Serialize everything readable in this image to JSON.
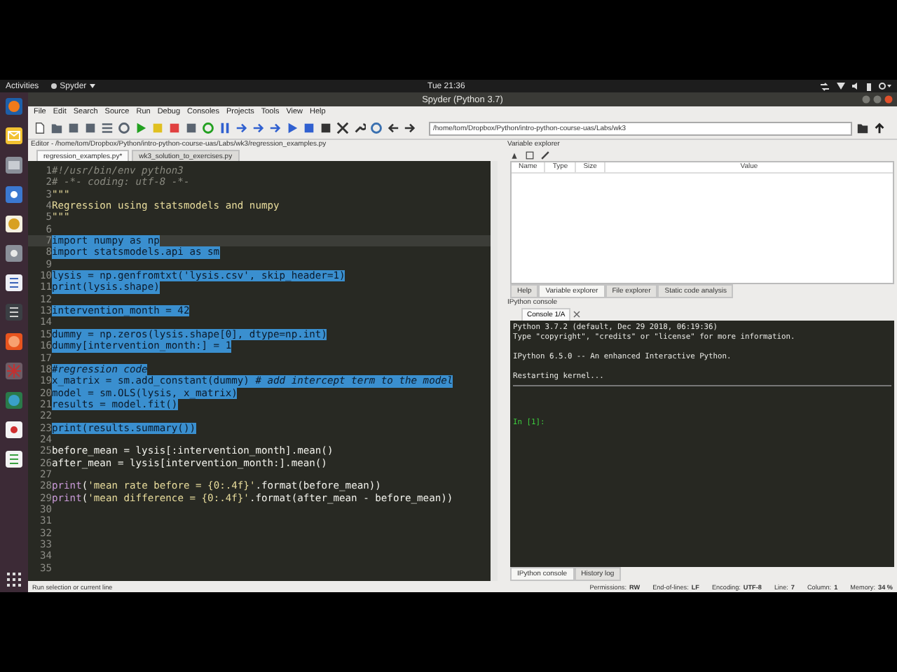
{
  "topbar": {
    "activities": "Activities",
    "app_menu": "Spyder",
    "clock": "Tue 21:36"
  },
  "window": {
    "title": "Spyder (Python 3.7)"
  },
  "menu": [
    "File",
    "Edit",
    "Search",
    "Source",
    "Run",
    "Debug",
    "Consoles",
    "Projects",
    "Tools",
    "View",
    "Help"
  ],
  "toolbar": {
    "path": "/home/tom/Dropbox/Python/intro-python-course-uas/Labs/wk3"
  },
  "editor": {
    "title": "Editor - /home/tom/Dropbox/Python/intro-python-course-uas/Labs/wk3/regression_examples.py",
    "tabs": [
      {
        "label": "regression_examples.py*",
        "selected": true
      },
      {
        "label": "wk3_solution_to_exercises.py",
        "selected": false
      }
    ],
    "lines": [
      {
        "number": "1",
        "selected": false,
        "current": false,
        "parts": [
          {
            "kind": "comment",
            "text": "#!/usr/bin/env python3"
          }
        ]
      },
      {
        "number": "2",
        "selected": false,
        "current": false,
        "parts": [
          {
            "kind": "comment",
            "text": "# -*- coding: utf-8 -*-"
          }
        ]
      },
      {
        "number": "3",
        "selected": false,
        "current": false,
        "parts": [
          {
            "kind": "string",
            "text": "\"\"\""
          }
        ]
      },
      {
        "number": "4",
        "selected": false,
        "current": false,
        "parts": [
          {
            "kind": "string",
            "text": "Regression using statsmodels and numpy"
          }
        ]
      },
      {
        "number": "5",
        "selected": false,
        "current": false,
        "parts": [
          {
            "kind": "string",
            "text": "\"\"\""
          }
        ]
      },
      {
        "number": "6",
        "current": false
      },
      {
        "number": "7",
        "selected": true,
        "current": true,
        "parts": [
          {
            "kind": "code",
            "text": "import numpy as np"
          }
        ]
      },
      {
        "number": "8",
        "selected": true,
        "current": false,
        "parts": [
          {
            "kind": "code",
            "text": "import statsmodels.api as sm"
          }
        ]
      },
      {
        "number": "9",
        "current": false
      },
      {
        "number": "10",
        "selected": true,
        "current": false,
        "parts": [
          {
            "kind": "code",
            "text": "lysis = np.genfromtxt('lysis.csv', skip_header=1)"
          }
        ]
      },
      {
        "number": "11",
        "selected": true,
        "current": false,
        "parts": [
          {
            "kind": "code",
            "text": "print(lysis.shape)"
          }
        ]
      },
      {
        "number": "12",
        "current": false
      },
      {
        "number": "13",
        "selected": true,
        "current": false,
        "parts": [
          {
            "kind": "code",
            "text": "intervention_month = 42"
          }
        ]
      },
      {
        "number": "14",
        "current": false
      },
      {
        "number": "15",
        "selected": true,
        "current": false,
        "parts": [
          {
            "kind": "code",
            "text": "dummy = np.zeros(lysis.shape[0], dtype=np.int)"
          }
        ]
      },
      {
        "number": "16",
        "selected": true,
        "current": false,
        "parts": [
          {
            "kind": "code",
            "text": "dummy[intervention_month:] = 1"
          }
        ]
      },
      {
        "number": "17",
        "current": false
      },
      {
        "number": "18",
        "selected": true,
        "current": false,
        "parts": [
          {
            "kind": "comment",
            "text": "#regression code"
          }
        ]
      },
      {
        "number": "19",
        "selected": true,
        "current": false,
        "parts": [
          {
            "kind": "code",
            "text": "x_matrix = sm.add_constant(dummy) "
          },
          {
            "kind": "comment",
            "text": "# add intercept term to the model"
          }
        ]
      },
      {
        "number": "20",
        "selected": true,
        "current": false,
        "parts": [
          {
            "kind": "code",
            "text": "model = sm.OLS(lysis, x_matrix)"
          }
        ]
      },
      {
        "number": "21",
        "selected": true,
        "current": false,
        "parts": [
          {
            "kind": "code",
            "text": "results = model.fit()"
          }
        ]
      },
      {
        "number": "22",
        "current": false
      },
      {
        "number": "23",
        "selected": true,
        "current": false,
        "parts": [
          {
            "kind": "code",
            "text": "print(results.summary())"
          }
        ]
      },
      {
        "number": "24",
        "current": false
      },
      {
        "number": "25",
        "selected": false,
        "current": false,
        "parts": [
          {
            "kind": "code",
            "text": "before_mean = lysis[:intervention_month].mean()"
          }
        ]
      },
      {
        "number": "26",
        "selected": false,
        "current": false,
        "parts": [
          {
            "kind": "code",
            "text": "after_mean = lysis[intervention_month:].mean()"
          }
        ]
      },
      {
        "number": "27",
        "current": false
      },
      {
        "number": "28",
        "selected": false,
        "current": false,
        "parts": [
          {
            "kind": "keyword",
            "text": "print"
          },
          {
            "kind": "code",
            "text": "("
          },
          {
            "kind": "string",
            "text": "'mean rate before = {0:.4f}'"
          },
          {
            "kind": "code",
            "text": ".format(before_mean))"
          }
        ]
      },
      {
        "number": "29",
        "selected": false,
        "current": false,
        "parts": [
          {
            "kind": "keyword",
            "text": "print"
          },
          {
            "kind": "code",
            "text": "("
          },
          {
            "kind": "string",
            "text": "'mean difference = {0:.4f}'"
          },
          {
            "kind": "code",
            "text": ".format(after_mean - before_mean))"
          }
        ]
      },
      {
        "number": "30",
        "current": false
      },
      {
        "number": "31",
        "current": false
      },
      {
        "number": "32",
        "current": false
      },
      {
        "number": "33",
        "current": false
      },
      {
        "number": "34",
        "current": false
      },
      {
        "number": "35",
        "current": false
      }
    ]
  },
  "variable_explorer": {
    "title": "Variable explorer",
    "columns": [
      "Name",
      "Type",
      "Size",
      "Value"
    ],
    "tabs": [
      {
        "label": "Help",
        "selected": false
      },
      {
        "label": "Variable explorer",
        "selected": true
      },
      {
        "label": "File explorer",
        "selected": false
      },
      {
        "label": "Static code analysis",
        "selected": false
      }
    ]
  },
  "console": {
    "title": "IPython console",
    "tab": "Console 1/A",
    "lines": [
      {
        "kind": "output",
        "text": "Python 3.7.2 (default, Dec 29 2018, 06:19:36)"
      },
      {
        "kind": "output",
        "text": "Type \"copyright\", \"credits\" or \"license\" for more information."
      },
      {
        "kind": "blank"
      },
      {
        "kind": "output",
        "text": "IPython 6.5.0 -- An enhanced Interactive Python."
      },
      {
        "kind": "blank"
      },
      {
        "kind": "output",
        "text": "Restarting kernel..."
      },
      {
        "kind": "rule"
      },
      {
        "kind": "blank"
      },
      {
        "kind": "blank"
      },
      {
        "kind": "blank"
      },
      {
        "kind": "prompt",
        "text": "In [1]:"
      }
    ],
    "tabs": [
      {
        "label": "IPython console",
        "selected": true
      },
      {
        "label": "History log",
        "selected": false
      }
    ]
  },
  "status_bar": {
    "message": "Run selection or current line",
    "fields": [
      {
        "label": "Permissions:",
        "value": "RW"
      },
      {
        "label": "End-of-lines:",
        "value": "LF"
      },
      {
        "label": "Encoding:",
        "value": "UTF-8"
      },
      {
        "label": "Line:",
        "value": "7"
      },
      {
        "label": "Column:",
        "value": "1"
      },
      {
        "label": "Memory:",
        "value": "34 %"
      }
    ]
  }
}
